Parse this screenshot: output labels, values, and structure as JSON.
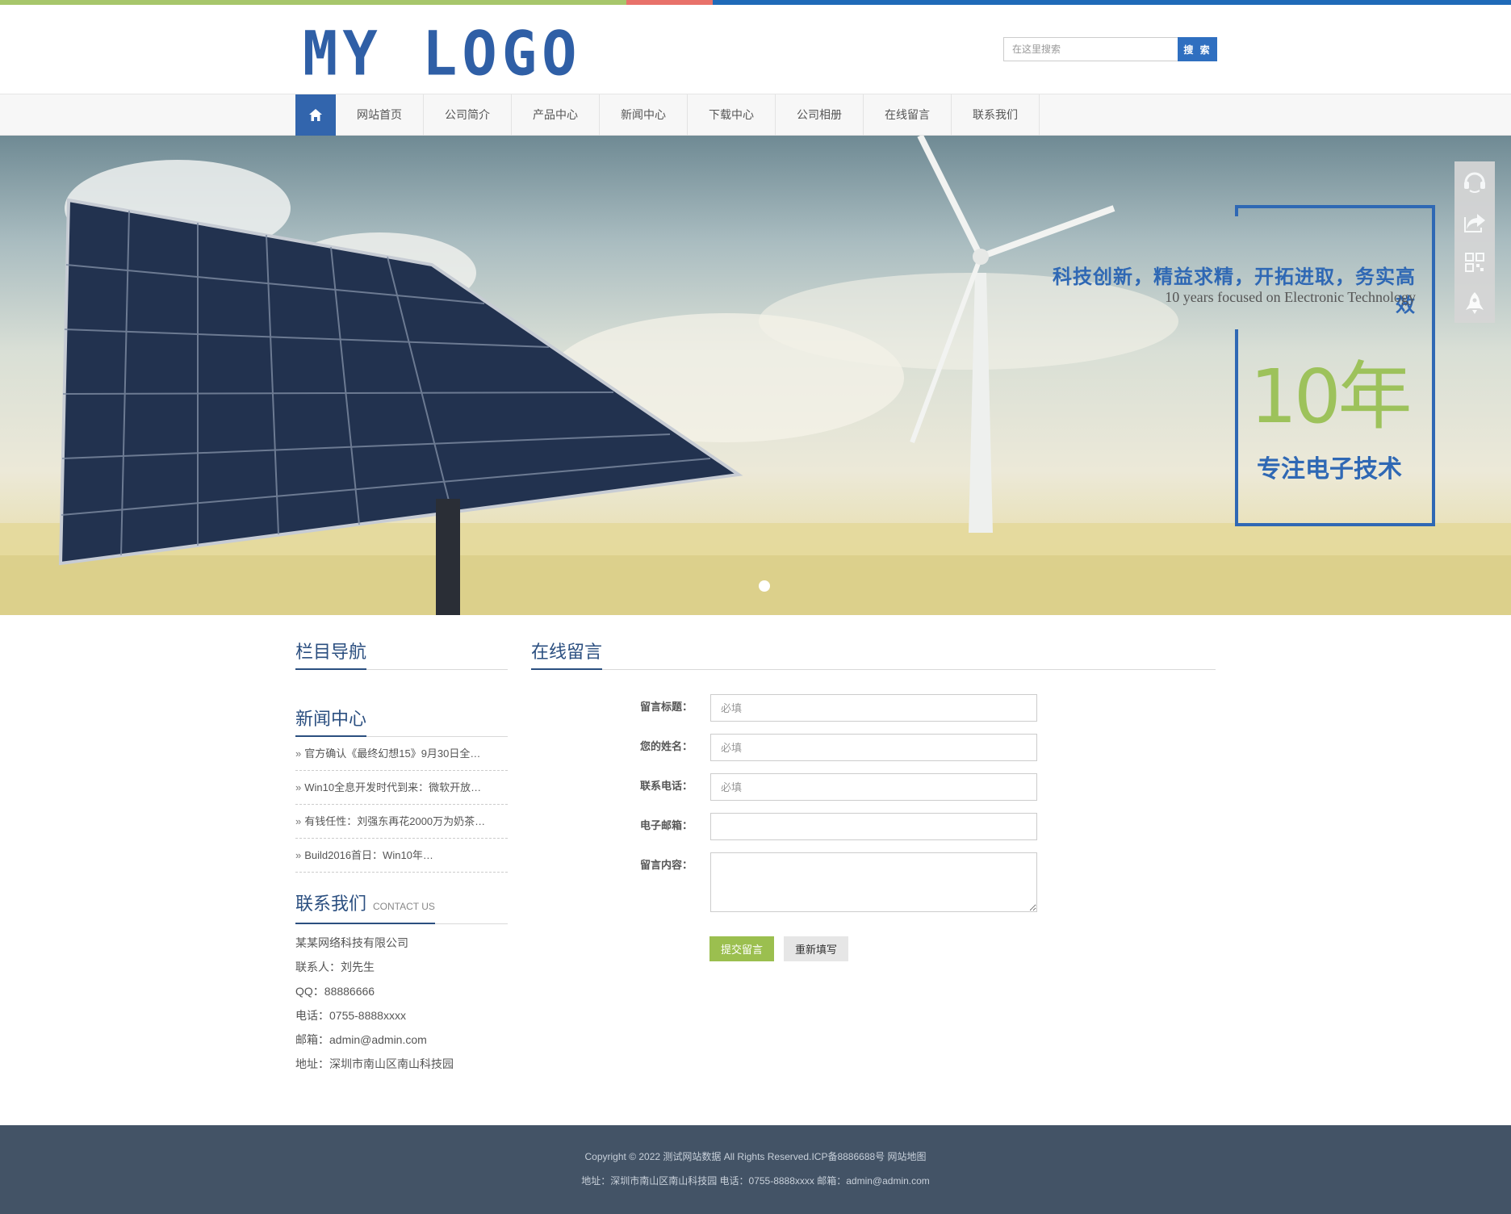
{
  "colors": {
    "brand": "#2f5fa6",
    "accent_green": "#9bbf4f",
    "footer_bg": "#435366"
  },
  "header": {
    "logo_text": "MY LOGO",
    "search": {
      "placeholder": "在这里搜索",
      "button_label": "搜 索"
    }
  },
  "nav": {
    "home_icon": "home-icon",
    "items": [
      "网站首页",
      "公司简介",
      "产品中心",
      "新闻中心",
      "下载中心",
      "公司相册",
      "在线留言",
      "联系我们"
    ]
  },
  "banner": {
    "slogan": "科技创新，精益求精，开拓进取，务实高效",
    "subtitle": "10 years focused on Electronic Technology",
    "years": "10年",
    "tagline": "专注电子技术"
  },
  "side_tools": [
    "headset-icon",
    "share-icon",
    "qrcode-icon",
    "rocket-icon"
  ],
  "sidebar": {
    "category_title": "栏目导航",
    "news_title": "新闻中心",
    "news": [
      "官方确认《最终幻想15》9月30日全…",
      "Win10全息开发时代到来：微软开放…",
      "有钱任性：刘强东再花2000万为奶茶…",
      "Build2016首日：Win10年…"
    ],
    "contact_title": "联系我们",
    "contact_title_en": "CONTACT US",
    "contact": [
      "某某网络科技有限公司",
      "联系人：刘先生",
      "QQ：88886666",
      "电话：0755-8888xxxx",
      "邮箱：admin@admin.com",
      "地址：深圳市南山区南山科技园"
    ]
  },
  "main": {
    "title": "在线留言",
    "form": {
      "subject_label": "留言标题：",
      "subject_placeholder": "必填",
      "name_label": "您的姓名：",
      "name_placeholder": "必填",
      "phone_label": "联系电话：",
      "phone_placeholder": "必填",
      "email_label": "电子邮箱：",
      "email_placeholder": "",
      "content_label": "留言内容：",
      "submit_label": "提交留言",
      "reset_label": "重新填写"
    }
  },
  "footer": {
    "line1": "Copyright © 2022 测试网站数据 All Rights Reserved.ICP备8886688号 网站地图",
    "line2": "地址：深圳市南山区南山科技园 电话：0755-8888xxxx 邮箱：admin@admin.com"
  }
}
